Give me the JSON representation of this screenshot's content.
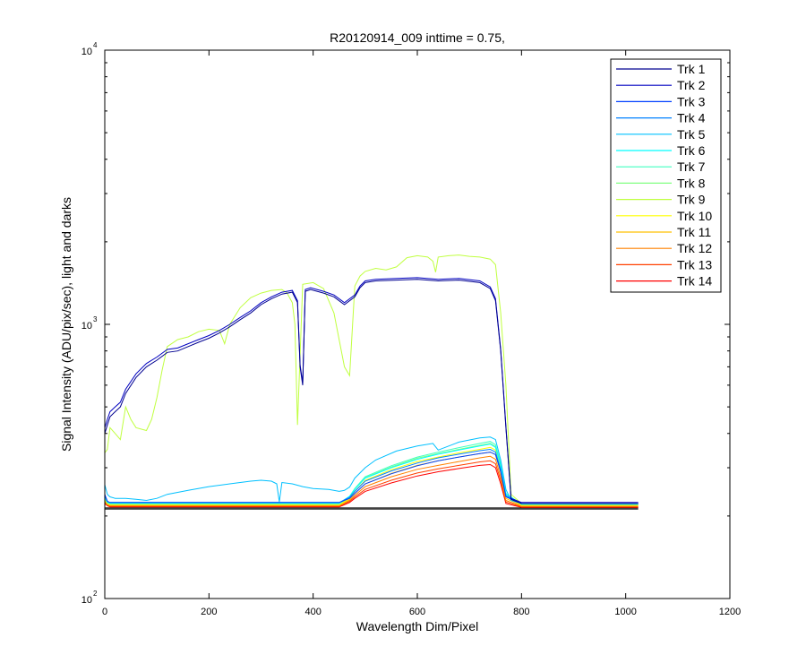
{
  "chart_data": {
    "type": "line",
    "title": "R20120914_009 inttime = 0.75,",
    "xlabel": "Wavelength Dim/Pixel",
    "ylabel": "Signal Intensity (ADU/pix/sec), light and darks",
    "xlim": [
      0,
      1200
    ],
    "ylim": [
      100,
      10000
    ],
    "yscale": "log",
    "grid": false,
    "legend_position": "top-right",
    "x_ticks": [
      "0",
      "200",
      "400",
      "600",
      "800",
      "1000",
      "1200"
    ],
    "y_ticks": [
      {
        "base": "10",
        "exp": "2"
      },
      {
        "base": "10",
        "exp": "3"
      },
      {
        "base": "10",
        "exp": "4"
      }
    ],
    "series": [
      {
        "name": "Trk 1",
        "color": "#000090",
        "x": [
          0,
          5,
          10,
          20,
          30,
          40,
          60,
          80,
          100,
          120,
          140,
          160,
          180,
          200,
          220,
          240,
          260,
          280,
          300,
          320,
          340,
          360,
          370,
          375,
          380,
          385,
          395,
          420,
          440,
          460,
          480,
          490,
          500,
          520,
          560,
          600,
          640,
          680,
          720,
          740,
          750,
          760,
          770,
          780,
          800,
          850,
          900,
          1000,
          1024
        ],
        "y": [
          400,
          430,
          460,
          480,
          500,
          560,
          640,
          700,
          740,
          790,
          800,
          830,
          860,
          890,
          930,
          980,
          1040,
          1100,
          1180,
          1240,
          1290,
          1310,
          1200,
          700,
          600,
          1320,
          1340,
          1300,
          1260,
          1180,
          1260,
          1360,
          1420,
          1440,
          1450,
          1460,
          1440,
          1450,
          1420,
          1350,
          1220,
          800,
          420,
          230,
          222,
          222,
          222,
          222,
          222
        ]
      },
      {
        "name": "Trk 2",
        "color": "#0000c0",
        "x": [
          0,
          5,
          10,
          20,
          30,
          40,
          60,
          80,
          100,
          120,
          140,
          160,
          180,
          200,
          220,
          240,
          260,
          280,
          300,
          320,
          340,
          360,
          370,
          375,
          380,
          385,
          395,
          420,
          440,
          460,
          480,
          490,
          500,
          520,
          560,
          600,
          640,
          680,
          720,
          740,
          750,
          760,
          770,
          780,
          800,
          850,
          900,
          1000,
          1024
        ],
        "y": [
          420,
          450,
          480,
          500,
          520,
          580,
          660,
          720,
          760,
          810,
          820,
          850,
          880,
          910,
          950,
          1000,
          1060,
          1120,
          1200,
          1260,
          1310,
          1330,
          1220,
          710,
          610,
          1340,
          1360,
          1320,
          1280,
          1200,
          1280,
          1380,
          1440,
          1460,
          1470,
          1480,
          1460,
          1470,
          1440,
          1370,
          1240,
          810,
          425,
          232,
          224,
          224,
          224,
          224,
          224
        ]
      },
      {
        "name": "Trk 3",
        "color": "#0040ff",
        "x": [
          0,
          5,
          10,
          40,
          100,
          200,
          300,
          400,
          450,
          470,
          480,
          500,
          550,
          600,
          640,
          680,
          720,
          740,
          750,
          760,
          770,
          800,
          900,
          1024
        ],
        "y": [
          240,
          226,
          224,
          224,
          224,
          224,
          224,
          224,
          224,
          232,
          242,
          262,
          285,
          305,
          318,
          328,
          338,
          342,
          335,
          290,
          235,
          222,
          222,
          222
        ]
      },
      {
        "name": "Trk 4",
        "color": "#0080ff",
        "x": [
          0,
          5,
          10,
          40,
          100,
          200,
          300,
          400,
          450,
          470,
          480,
          500,
          550,
          600,
          640,
          680,
          720,
          740,
          750,
          760,
          770,
          800,
          900,
          1024
        ],
        "y": [
          238,
          226,
          224,
          224,
          224,
          224,
          224,
          224,
          224,
          234,
          246,
          268,
          292,
          312,
          326,
          336,
          346,
          350,
          342,
          295,
          237,
          222,
          222,
          222
        ]
      },
      {
        "name": "Trk 5",
        "color": "#00c0ff",
        "x": [
          0,
          5,
          10,
          20,
          40,
          60,
          80,
          100,
          120,
          160,
          200,
          240,
          280,
          300,
          320,
          330,
          335,
          340,
          360,
          380,
          400,
          430,
          450,
          460,
          470,
          480,
          500,
          520,
          560,
          600,
          630,
          640,
          680,
          720,
          740,
          750,
          760,
          770,
          780,
          800,
          900,
          1024
        ],
        "y": [
          260,
          240,
          235,
          232,
          232,
          230,
          228,
          232,
          240,
          248,
          256,
          262,
          268,
          270,
          268,
          262,
          225,
          265,
          262,
          256,
          252,
          250,
          246,
          248,
          255,
          275,
          300,
          320,
          345,
          360,
          368,
          348,
          372,
          385,
          388,
          380,
          320,
          250,
          228,
          222,
          222,
          222
        ]
      },
      {
        "name": "Trk 6",
        "color": "#00ffff",
        "x": [
          0,
          5,
          10,
          40,
          100,
          200,
          300,
          400,
          450,
          470,
          480,
          500,
          550,
          600,
          640,
          680,
          720,
          740,
          750,
          760,
          770,
          800,
          900,
          1024
        ],
        "y": [
          236,
          225,
          223,
          223,
          223,
          223,
          223,
          223,
          223,
          236,
          250,
          275,
          300,
          322,
          336,
          348,
          360,
          366,
          356,
          305,
          240,
          221,
          221,
          221
        ]
      },
      {
        "name": "Trk 7",
        "color": "#40ffc0",
        "x": [
          0,
          5,
          10,
          40,
          100,
          200,
          300,
          400,
          450,
          470,
          480,
          500,
          550,
          600,
          640,
          680,
          720,
          740,
          750,
          760,
          770,
          800,
          900,
          1024
        ],
        "y": [
          234,
          224,
          222,
          222,
          222,
          222,
          222,
          222,
          222,
          236,
          252,
          278,
          305,
          328,
          342,
          355,
          368,
          374,
          364,
          312,
          242,
          221,
          221,
          221
        ]
      },
      {
        "name": "Trk 8",
        "color": "#80ff80",
        "x": [
          0,
          5,
          10,
          40,
          100,
          200,
          300,
          400,
          450,
          470,
          480,
          500,
          550,
          600,
          640,
          680,
          720,
          740,
          750,
          760,
          770,
          800,
          900,
          1024
        ],
        "y": [
          232,
          223,
          221,
          221,
          221,
          221,
          221,
          221,
          221,
          235,
          250,
          276,
          302,
          325,
          338,
          350,
          362,
          368,
          358,
          306,
          240,
          220,
          220,
          220
        ]
      },
      {
        "name": "Trk 9",
        "color": "#c0ff40",
        "x": [
          0,
          5,
          10,
          20,
          30,
          40,
          50,
          60,
          80,
          90,
          100,
          110,
          120,
          140,
          160,
          180,
          200,
          220,
          230,
          240,
          260,
          280,
          300,
          320,
          340,
          350,
          360,
          365,
          370,
          380,
          400,
          420,
          440,
          460,
          470,
          480,
          490,
          500,
          520,
          540,
          560,
          580,
          600,
          620,
          630,
          635,
          640,
          660,
          680,
          700,
          720,
          740,
          750,
          760,
          770,
          780,
          800,
          900,
          1024
        ],
        "y": [
          340,
          350,
          420,
          400,
          380,
          500,
          450,
          420,
          410,
          450,
          540,
          680,
          830,
          880,
          900,
          940,
          960,
          950,
          850,
          1000,
          1150,
          1250,
          1300,
          1330,
          1340,
          1300,
          1200,
          1000,
          430,
          1400,
          1420,
          1350,
          1100,
          700,
          650,
          1380,
          1500,
          1560,
          1600,
          1580,
          1620,
          1750,
          1780,
          1760,
          1700,
          1550,
          1760,
          1780,
          1790,
          1770,
          1760,
          1730,
          1650,
          1100,
          600,
          240,
          222,
          222,
          222
        ]
      },
      {
        "name": "Trk 10",
        "color": "#ffff00",
        "x": [
          0,
          5,
          10,
          40,
          100,
          200,
          300,
          400,
          450,
          470,
          480,
          500,
          550,
          600,
          640,
          680,
          720,
          740,
          750,
          760,
          770,
          800,
          900,
          1024
        ],
        "y": [
          230,
          222,
          220,
          220,
          220,
          220,
          220,
          220,
          220,
          232,
          246,
          270,
          295,
          316,
          328,
          340,
          350,
          356,
          348,
          298,
          236,
          219,
          219,
          219
        ]
      },
      {
        "name": "Trk 11",
        "color": "#ffc000",
        "x": [
          0,
          5,
          10,
          40,
          100,
          200,
          300,
          400,
          450,
          470,
          480,
          500,
          550,
          600,
          640,
          680,
          720,
          740,
          750,
          760,
          770,
          800,
          900,
          1024
        ],
        "y": [
          228,
          221,
          219,
          219,
          219,
          219,
          219,
          219,
          219,
          230,
          242,
          262,
          286,
          306,
          318,
          328,
          338,
          342,
          335,
          288,
          232,
          218,
          218,
          218
        ]
      },
      {
        "name": "Trk 12",
        "color": "#ff8000",
        "x": [
          0,
          5,
          10,
          40,
          100,
          200,
          300,
          400,
          450,
          470,
          480,
          500,
          550,
          600,
          640,
          680,
          720,
          740,
          750,
          760,
          770,
          800,
          900,
          1024
        ],
        "y": [
          226,
          220,
          218,
          218,
          218,
          218,
          218,
          218,
          218,
          228,
          238,
          256,
          278,
          296,
          306,
          316,
          326,
          330,
          322,
          278,
          228,
          217,
          217,
          217
        ]
      },
      {
        "name": "Trk 13",
        "color": "#ff4000",
        "x": [
          0,
          5,
          10,
          40,
          100,
          200,
          300,
          400,
          450,
          470,
          480,
          500,
          550,
          600,
          640,
          680,
          720,
          740,
          750,
          760,
          770,
          800,
          900,
          1024
        ],
        "y": [
          224,
          219,
          217,
          217,
          217,
          217,
          217,
          217,
          217,
          226,
          235,
          250,
          270,
          287,
          297,
          306,
          315,
          318,
          310,
          270,
          225,
          216,
          216,
          216
        ]
      },
      {
        "name": "Trk 14",
        "color": "#ff0000",
        "x": [
          0,
          5,
          10,
          40,
          100,
          200,
          300,
          400,
          450,
          470,
          480,
          500,
          550,
          600,
          640,
          680,
          720,
          740,
          750,
          760,
          770,
          800,
          900,
          1024
        ],
        "y": [
          222,
          218,
          216,
          216,
          216,
          216,
          216,
          216,
          216,
          224,
          232,
          246,
          264,
          280,
          290,
          298,
          306,
          308,
          300,
          262,
          222,
          215,
          215,
          215
        ]
      }
    ],
    "dark_series": [
      {
        "color": "#000000",
        "x": [
          0,
          100,
          200,
          300,
          400,
          500,
          600,
          700,
          800,
          900,
          1000,
          1024
        ],
        "y": [
          212,
          212,
          212,
          212,
          212,
          212,
          212,
          212,
          212,
          212,
          212,
          212
        ]
      },
      {
        "color": "#000000",
        "x": [
          0,
          100,
          200,
          300,
          400,
          500,
          600,
          700,
          800,
          900,
          1000,
          1024
        ],
        "y": [
          214,
          214,
          214,
          214,
          214,
          214,
          214,
          214,
          214,
          214,
          214,
          214
        ]
      }
    ]
  }
}
